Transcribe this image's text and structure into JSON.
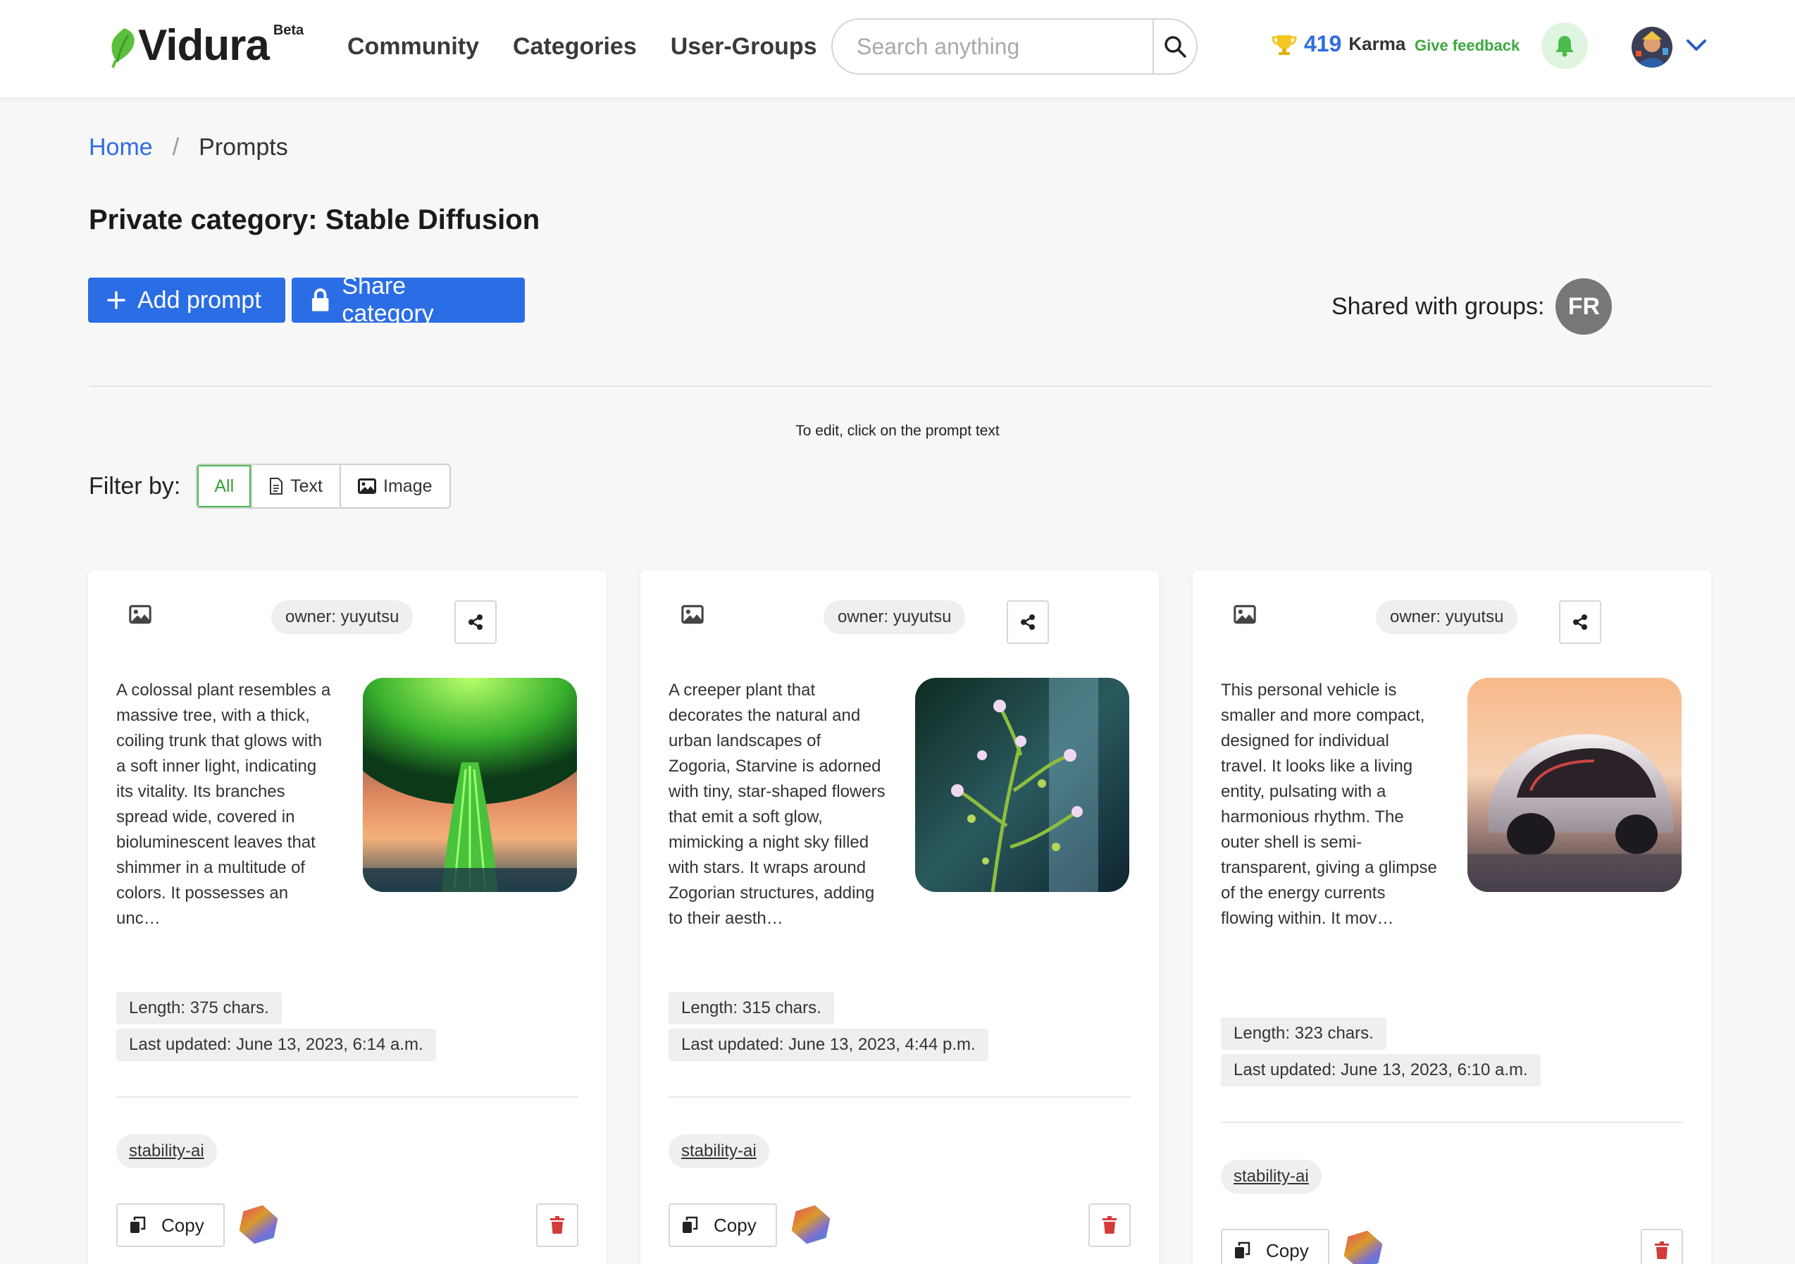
{
  "header": {
    "logo_text": "Vidura",
    "beta_label": "Beta",
    "nav": [
      "Community",
      "Categories",
      "User-Groups"
    ],
    "search_placeholder": "Search anything",
    "karma_value": "419",
    "karma_label": "Karma",
    "feedback_label": "Give feedback"
  },
  "breadcrumb": {
    "home": "Home",
    "separator": "/",
    "current": "Prompts"
  },
  "page_title": "Private category: Stable Diffusion",
  "actions": {
    "add_prompt": "Add prompt",
    "share_category": "Share category"
  },
  "shared": {
    "label": "Shared with groups:",
    "group_initials": "FR"
  },
  "hint": "To edit, click on the prompt text",
  "filter": {
    "label": "Filter by:",
    "options": [
      "All",
      "Text",
      "Image"
    ],
    "selected": "All"
  },
  "cards": [
    {
      "owner": "owner: yuyutsu",
      "text": "A colossal plant resembles a massive tree, with a thick, coiling trunk that glows with a soft inner light, indicating its vitality. Its branches spread wide, covered in bioluminescent leaves that shimmer in a multitude of colors. It possesses an unc…",
      "length": "Length: 375 chars.",
      "updated": "Last updated: June 13, 2023, 6:14 a.m.",
      "tag": "stability-ai",
      "copy_label": "Copy"
    },
    {
      "owner": "owner: yuyutsu",
      "text": "A creeper plant that decorates the natural and urban landscapes of Zogoria, Starvine is adorned with tiny, star-shaped flowers that emit a soft glow, mimicking a night sky filled with stars. It wraps around Zogorian structures, adding to their aesth…",
      "length": "Length: 315 chars.",
      "updated": "Last updated: June 13, 2023, 4:44 p.m.",
      "tag": "stability-ai",
      "copy_label": "Copy"
    },
    {
      "owner": "owner: yuyutsu",
      "text": "This personal vehicle is smaller and more compact, designed for individual travel. It looks like a living entity, pulsating with a harmonious rhythm. The outer shell is semi-transparent, giving a glimpse of the energy currents flowing within. It mov…",
      "length": "Length: 323 chars.",
      "updated": "Last updated: June 13, 2023, 6:10 a.m.",
      "tag": "stability-ai",
      "copy_label": "Copy"
    }
  ],
  "colors": {
    "accent": "#2b6de5",
    "green": "#3da83d",
    "danger": "#d33a3a"
  }
}
